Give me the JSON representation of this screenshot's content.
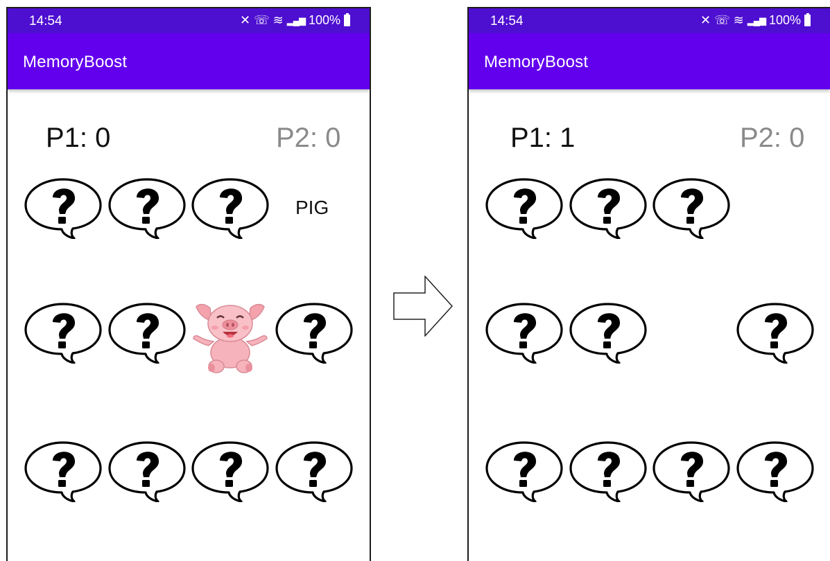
{
  "frames": [
    {
      "status": {
        "time": "14:54",
        "battery": "100%"
      },
      "app_title": "MemoryBoost",
      "scores": {
        "p1": "P1: 0",
        "p2": "P2: 0"
      },
      "revealed": {
        "word": "PIG",
        "image": "pig-image"
      }
    },
    {
      "status": {
        "time": "14:54",
        "battery": "100%"
      },
      "app_title": "MemoryBoost",
      "scores": {
        "p1": "P1: 1",
        "p2": "P2: 0"
      }
    }
  ],
  "icons": {
    "card_back": "question-bubble-icon",
    "transition": "right-arrow-icon",
    "status_icons": [
      "mute-icon",
      "wifi-calling-icon",
      "wifi-icon",
      "signal-icon",
      "battery-icon"
    ]
  },
  "colors": {
    "status_bar": "#4d0fd0",
    "app_bar": "#6200ee",
    "p1_score": "#111111",
    "p2_score": "#8a8a8a",
    "pig": "#f7b3bb"
  }
}
